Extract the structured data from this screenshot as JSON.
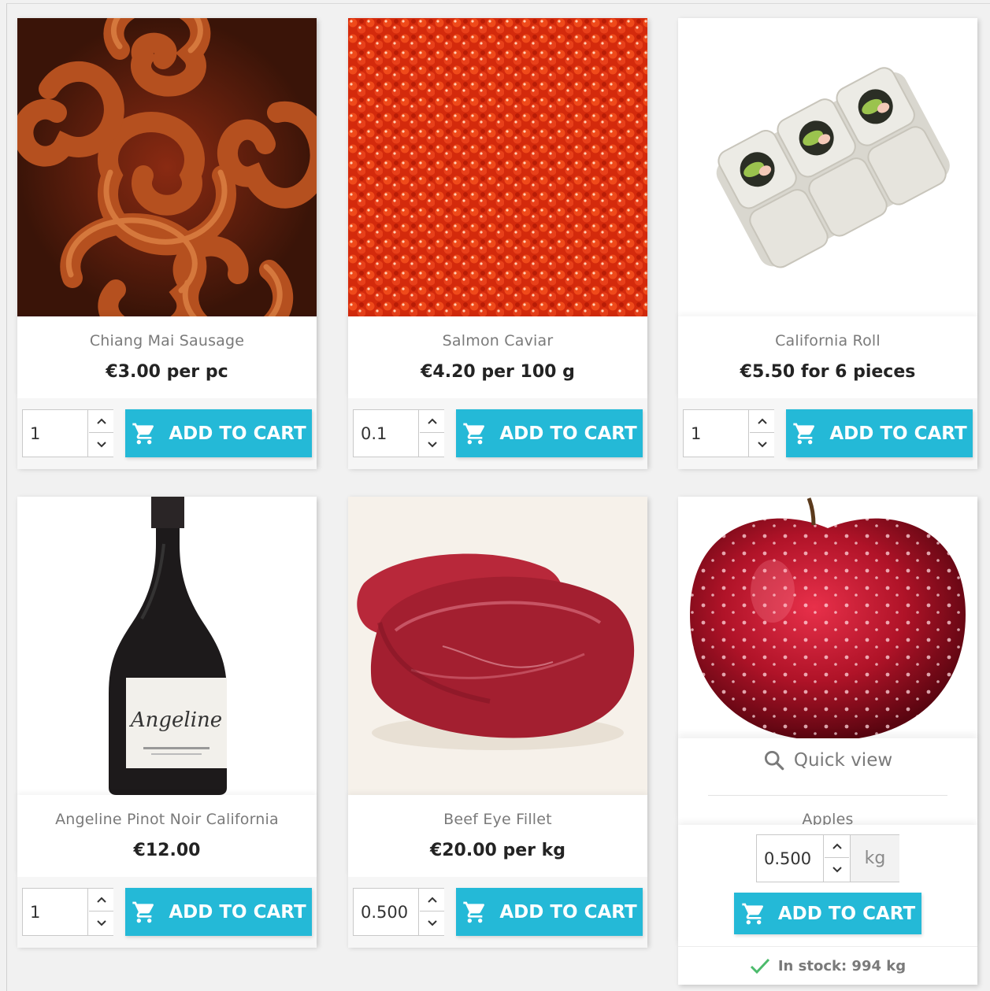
{
  "theme": {
    "accent": "#24b9d7",
    "stock_check": "#4cbb6c",
    "name_color": "#7a7a7a",
    "price_color": "#232323"
  },
  "icons": {
    "cart": "shopping-cart-icon",
    "spin_up": "chevron-up-icon",
    "spin_down": "chevron-down-icon",
    "quick_view": "search-icon",
    "in_stock": "checkmark-icon"
  },
  "add_to_cart_label": "ADD TO CART",
  "products": [
    {
      "name": "Chiang Mai Sausage",
      "price": "€3.00 per pc",
      "quantity": "1",
      "image": "sausage-photo"
    },
    {
      "name": "Salmon Caviar",
      "price": "€4.20 per 100 g",
      "quantity": "0.1",
      "image": "caviar-photo"
    },
    {
      "name": "California Roll",
      "price": "€5.50 for 6 pieces",
      "quantity": "1",
      "image": "sushi-photo"
    },
    {
      "name": "Angeline Pinot Noir California",
      "price": "€12.00",
      "quantity": "1",
      "image": "wine-bottle-photo",
      "label_script": "Angeline"
    },
    {
      "name": "Beef Eye Fillet",
      "price": "€20.00 per kg",
      "quantity": "0.500",
      "image": "beef-photo"
    },
    {
      "name": "Apples",
      "quick_view": "Quick view",
      "quantity": "0.500",
      "unit": "kg",
      "stock": "In stock: 994 kg",
      "image": "apple-photo"
    }
  ]
}
